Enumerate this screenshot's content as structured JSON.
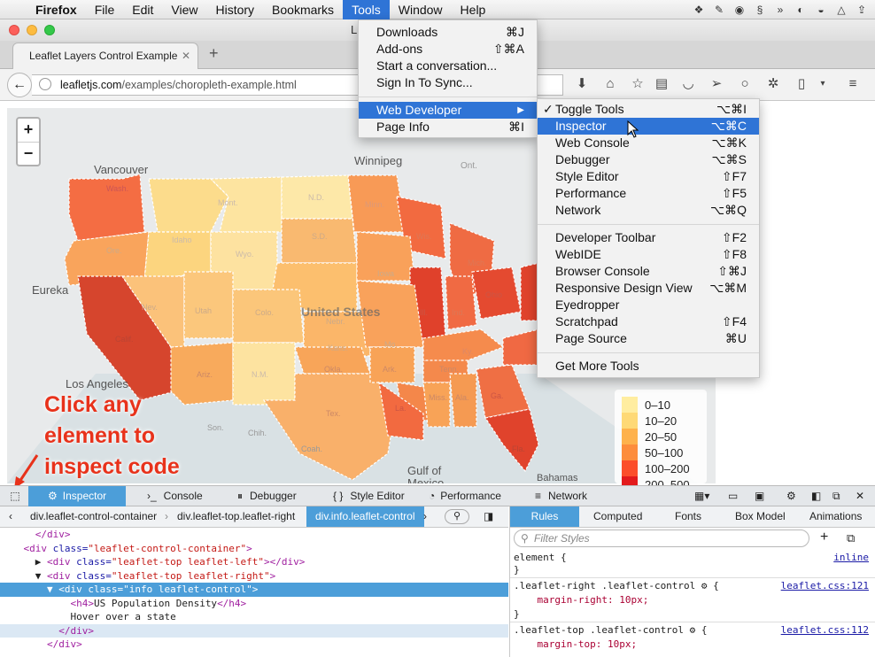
{
  "menubar": {
    "app": "Firefox",
    "items": [
      "File",
      "Edit",
      "View",
      "History",
      "Bookmarks",
      "Tools",
      "Window",
      "Help"
    ],
    "active": "Tools"
  },
  "window": {
    "title_fragment": "L"
  },
  "tab": {
    "title": "Leaflet Layers Control Example"
  },
  "url": {
    "host": "leafletjs.com",
    "path": "/examples/choropleth-example.html"
  },
  "tools_menu": {
    "items": [
      {
        "label": "Downloads",
        "shortcut": "⌘J"
      },
      {
        "label": "Add-ons",
        "shortcut": "⇧⌘A"
      },
      {
        "label": "Start a conversation...",
        "shortcut": ""
      },
      {
        "label": "Sign In To Sync...",
        "shortcut": ""
      },
      {
        "label": "Web Developer",
        "shortcut": "▶"
      },
      {
        "label": "Page Info",
        "shortcut": "⌘I"
      }
    ]
  },
  "web_dev_menu": {
    "items": [
      {
        "label": "Toggle Tools",
        "shortcut": "⌥⌘I",
        "check": "✓"
      },
      {
        "label": "Inspector",
        "shortcut": "⌥⌘C"
      },
      {
        "label": "Web Console",
        "shortcut": "⌥⌘K"
      },
      {
        "label": "Debugger",
        "shortcut": "⌥⌘S"
      },
      {
        "label": "Style Editor",
        "shortcut": "⇧F7"
      },
      {
        "label": "Performance",
        "shortcut": "⇧F5"
      },
      {
        "label": "Network",
        "shortcut": "⌥⌘Q"
      },
      {
        "label": "Developer Toolbar",
        "shortcut": "⇧F2"
      },
      {
        "label": "WebIDE",
        "shortcut": "⇧F8"
      },
      {
        "label": "Browser Console",
        "shortcut": "⇧⌘J"
      },
      {
        "label": "Responsive Design View",
        "shortcut": "⌥⌘M"
      },
      {
        "label": "Eyedropper",
        "shortcut": ""
      },
      {
        "label": "Scratchpad",
        "shortcut": "⇧F4"
      },
      {
        "label": "Page Source",
        "shortcut": "⌘U"
      },
      {
        "label": "Get More Tools",
        "shortcut": ""
      }
    ]
  },
  "map": {
    "zoom_in": "+",
    "zoom_out": "−",
    "labels": [
      "Vancouver",
      "Winnipeg",
      "Eureka",
      "United States",
      "Los Angeles",
      "Gulf of",
      "Mexico",
      "Bahamas",
      "Ont.",
      "Wash.",
      "Mont.",
      "N.D.",
      "Minn.",
      "Wis.",
      "Mich.",
      "Ore.",
      "Idaho",
      "Wyo.",
      "S.D.",
      "Iowa",
      "Nev.",
      "Utah",
      "Colo.",
      "Nebr.",
      "Ill.",
      "Ind.",
      "Ohio",
      "Calif.",
      "Kans.",
      "Mo.",
      "Ky.",
      "Ariz.",
      "N.M.",
      "Okla.",
      "Ark.",
      "Tenn.",
      "Tex.",
      "La.",
      "Miss.",
      "Ala.",
      "Ga.",
      "Fla.",
      "Son.",
      "Chih.",
      "Coah."
    ],
    "legend": [
      "0–10",
      "10–20",
      "20–50",
      "50–100",
      "100–200",
      "200–500"
    ],
    "legend_colors": [
      "#ffeda0",
      "#fed976",
      "#feb24c",
      "#fd8d3c",
      "#fc4e2a",
      "#e31a1c"
    ]
  },
  "annotation": {
    "line1": "Click any",
    "line2": "element to",
    "line3": "inspect code"
  },
  "devtools": {
    "tabs": [
      "Inspector",
      "Console",
      "Debugger",
      "Style Editor",
      "Performance",
      "Network"
    ],
    "crumbs": [
      "div.leaflet-control-container",
      "div.leaflet-top.leaflet-right",
      "div.info.leaflet-control"
    ],
    "markup": [
      {
        "indent": "      ",
        "tag": "</div>"
      },
      {
        "indent": "    ",
        "tag": "<div",
        "attr": " class=",
        "val": "\"leaflet-control-container\"",
        "end": ">"
      },
      {
        "indent": "      ▶ ",
        "tag": "<div",
        "attr": " class=",
        "val": "\"leaflet-top leaflet-left\"",
        "end": "></div>"
      },
      {
        "indent": "      ▼ ",
        "tag": "<div",
        "attr": " class=",
        "val": "\"leaflet-top leaflet-right\"",
        "end": ">"
      },
      {
        "indent": "        ▼ ",
        "tag": "<div",
        "attr": " class=",
        "val": "\"info leaflet-control\"",
        "end": ">"
      },
      {
        "indent": "            ",
        "tag": "<h4>",
        "text": "US Population Density",
        "end": "</h4>"
      },
      {
        "indent": "            ",
        "text": "Hover over a state"
      },
      {
        "indent": "          ",
        "tag": "</div>"
      },
      {
        "indent": "        ",
        "tag": "</div>"
      }
    ],
    "side_tabs": [
      "Rules",
      "Computed",
      "Fonts",
      "Box Model",
      "Animations"
    ],
    "filter_placeholder": "Filter Styles",
    "rules": [
      {
        "text": "element {",
        "src": "inline"
      },
      {
        "text": "}",
        "src": ""
      },
      {
        "text": ".leaflet-right .leaflet-control ⚙ {",
        "src": "leaflet.css:121"
      },
      {
        "text": "    margin-right: 10px;",
        "src": ""
      },
      {
        "text": "}",
        "src": ""
      },
      {
        "text": ".leaflet-top .leaflet-control ⚙ {",
        "src": "leaflet.css:112"
      },
      {
        "text": "    margin-top: 10px;",
        "src": ""
      }
    ]
  }
}
